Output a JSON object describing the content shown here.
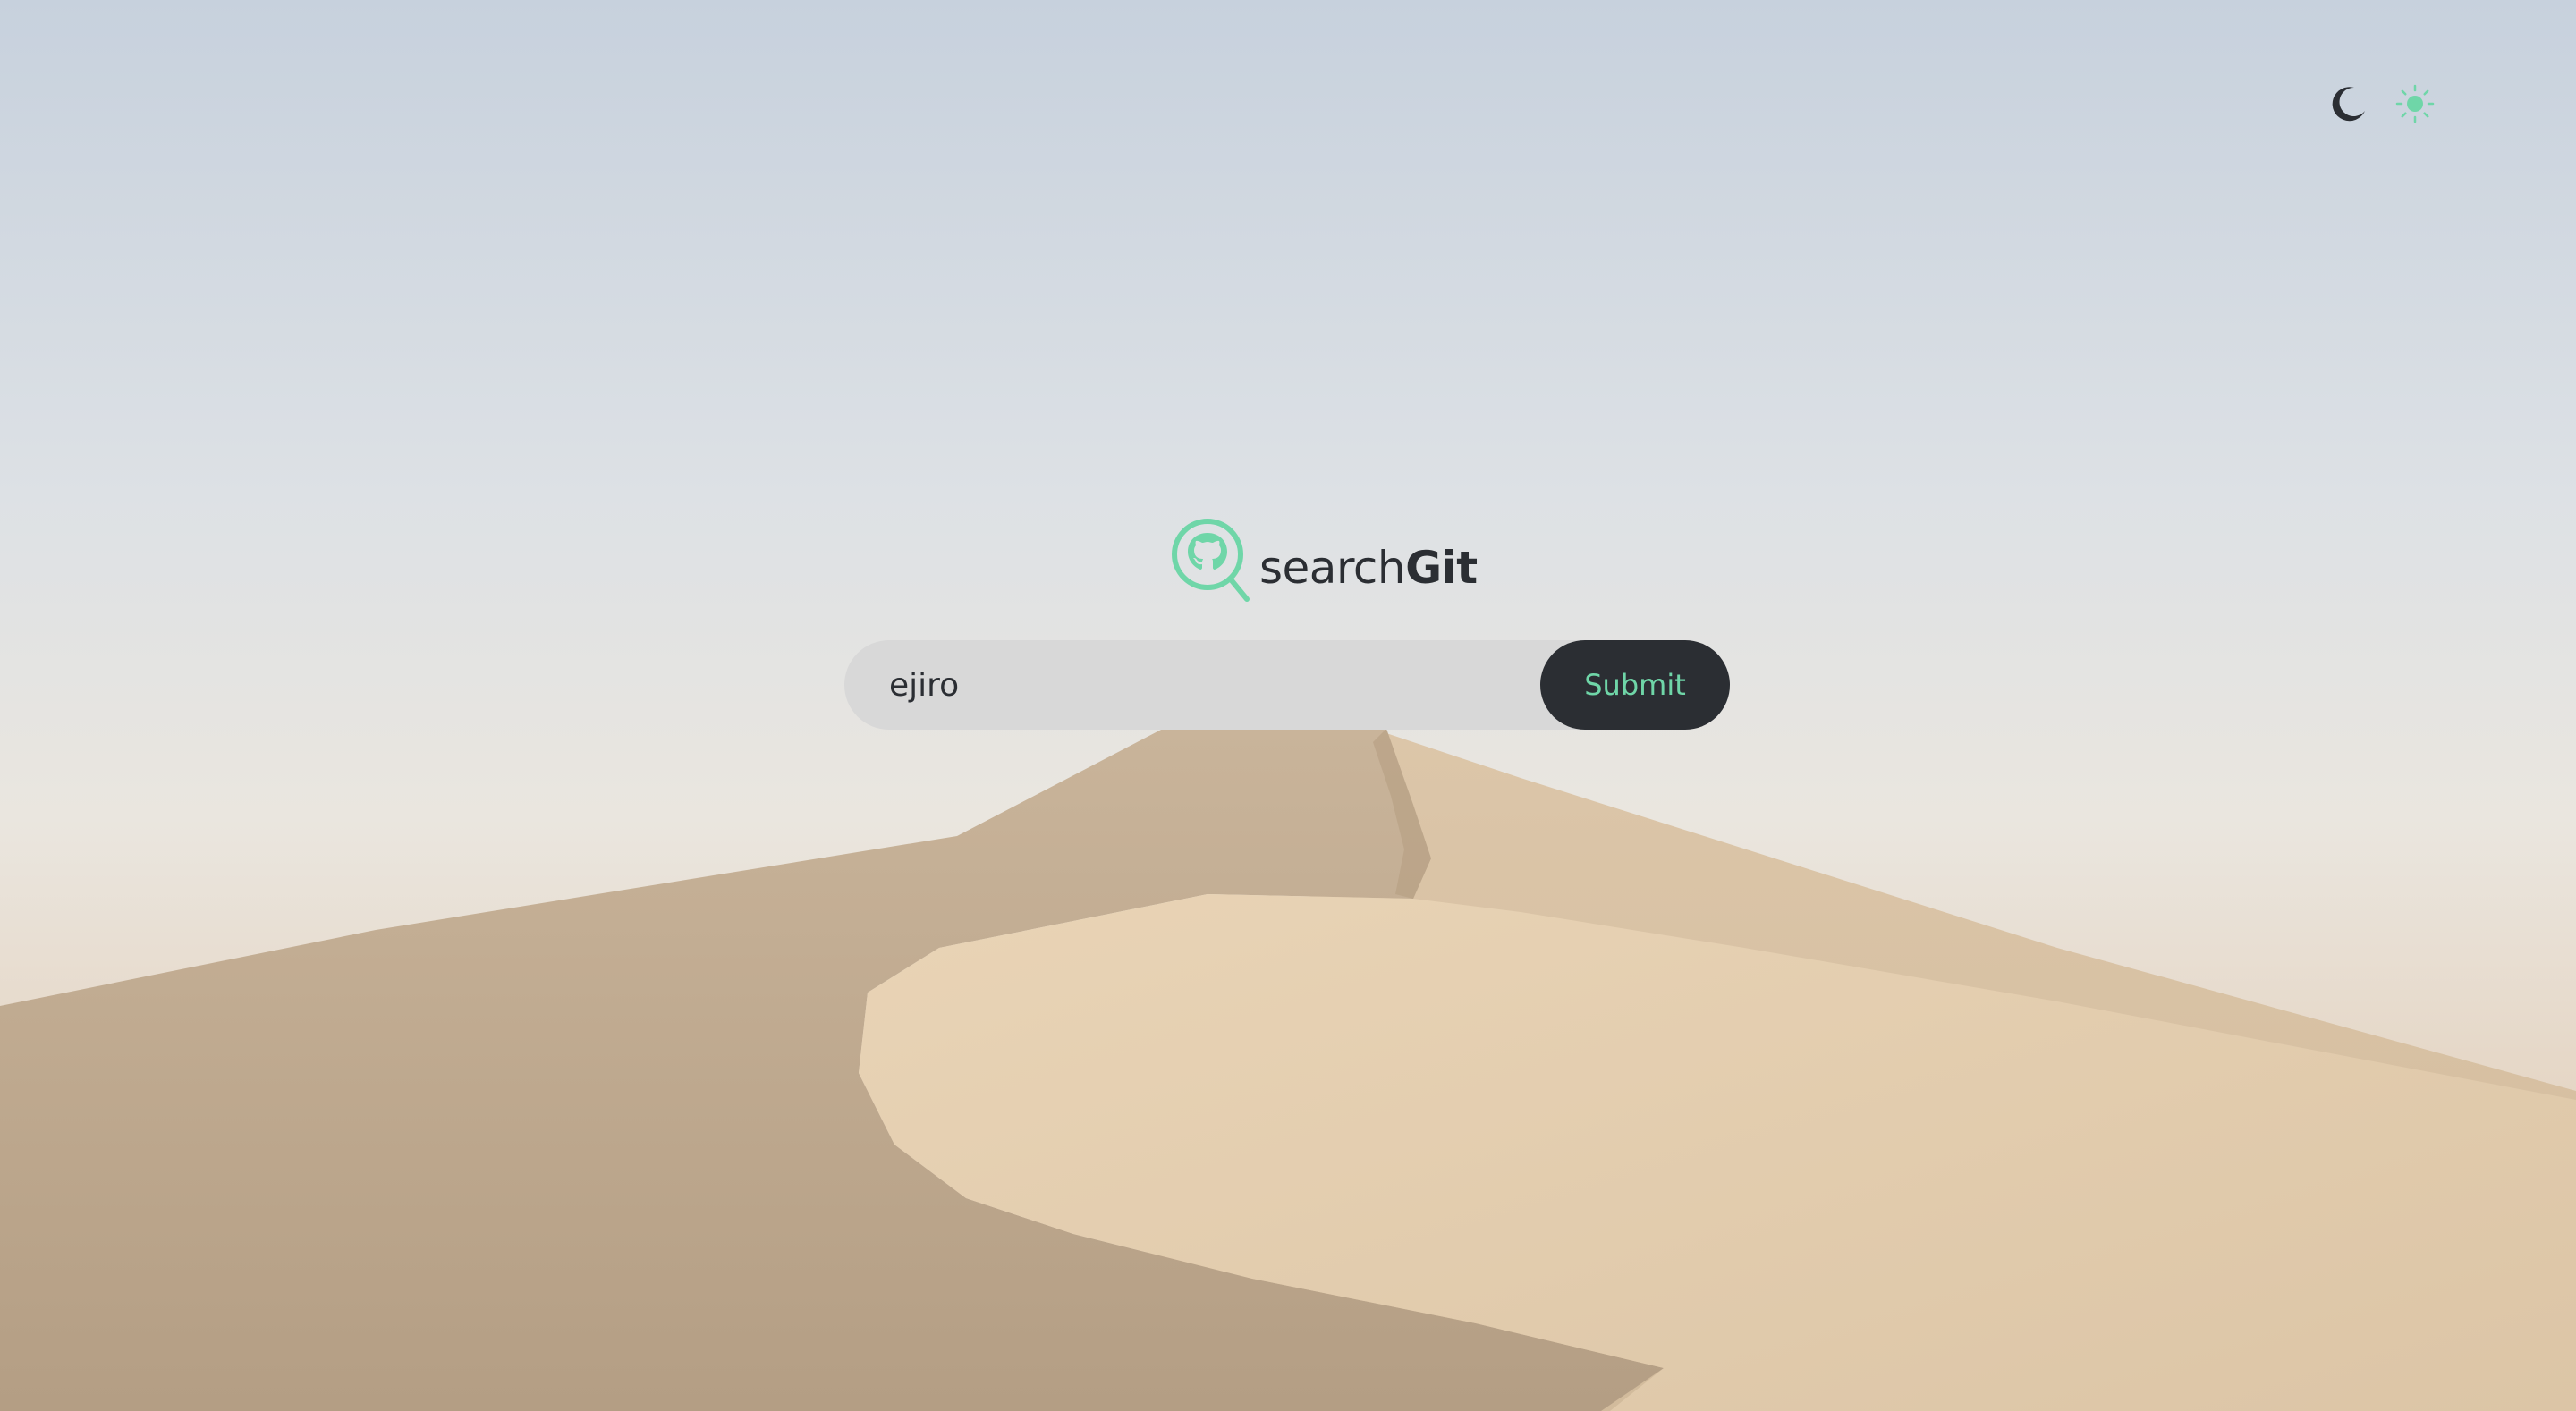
{
  "app": {
    "name_light": "search",
    "name_bold": "Git"
  },
  "theme": {
    "accent": "#6fd6a8",
    "dark": "#2b2e33",
    "input_bg": "#d8d8d8",
    "toggles": [
      {
        "icon": "moon-icon",
        "mode": "dark"
      },
      {
        "icon": "sun-icon",
        "mode": "light",
        "active": true
      }
    ]
  },
  "search": {
    "value": "ejiro",
    "submit_label": "Submit"
  },
  "background": {
    "scene": "desert-dune"
  }
}
